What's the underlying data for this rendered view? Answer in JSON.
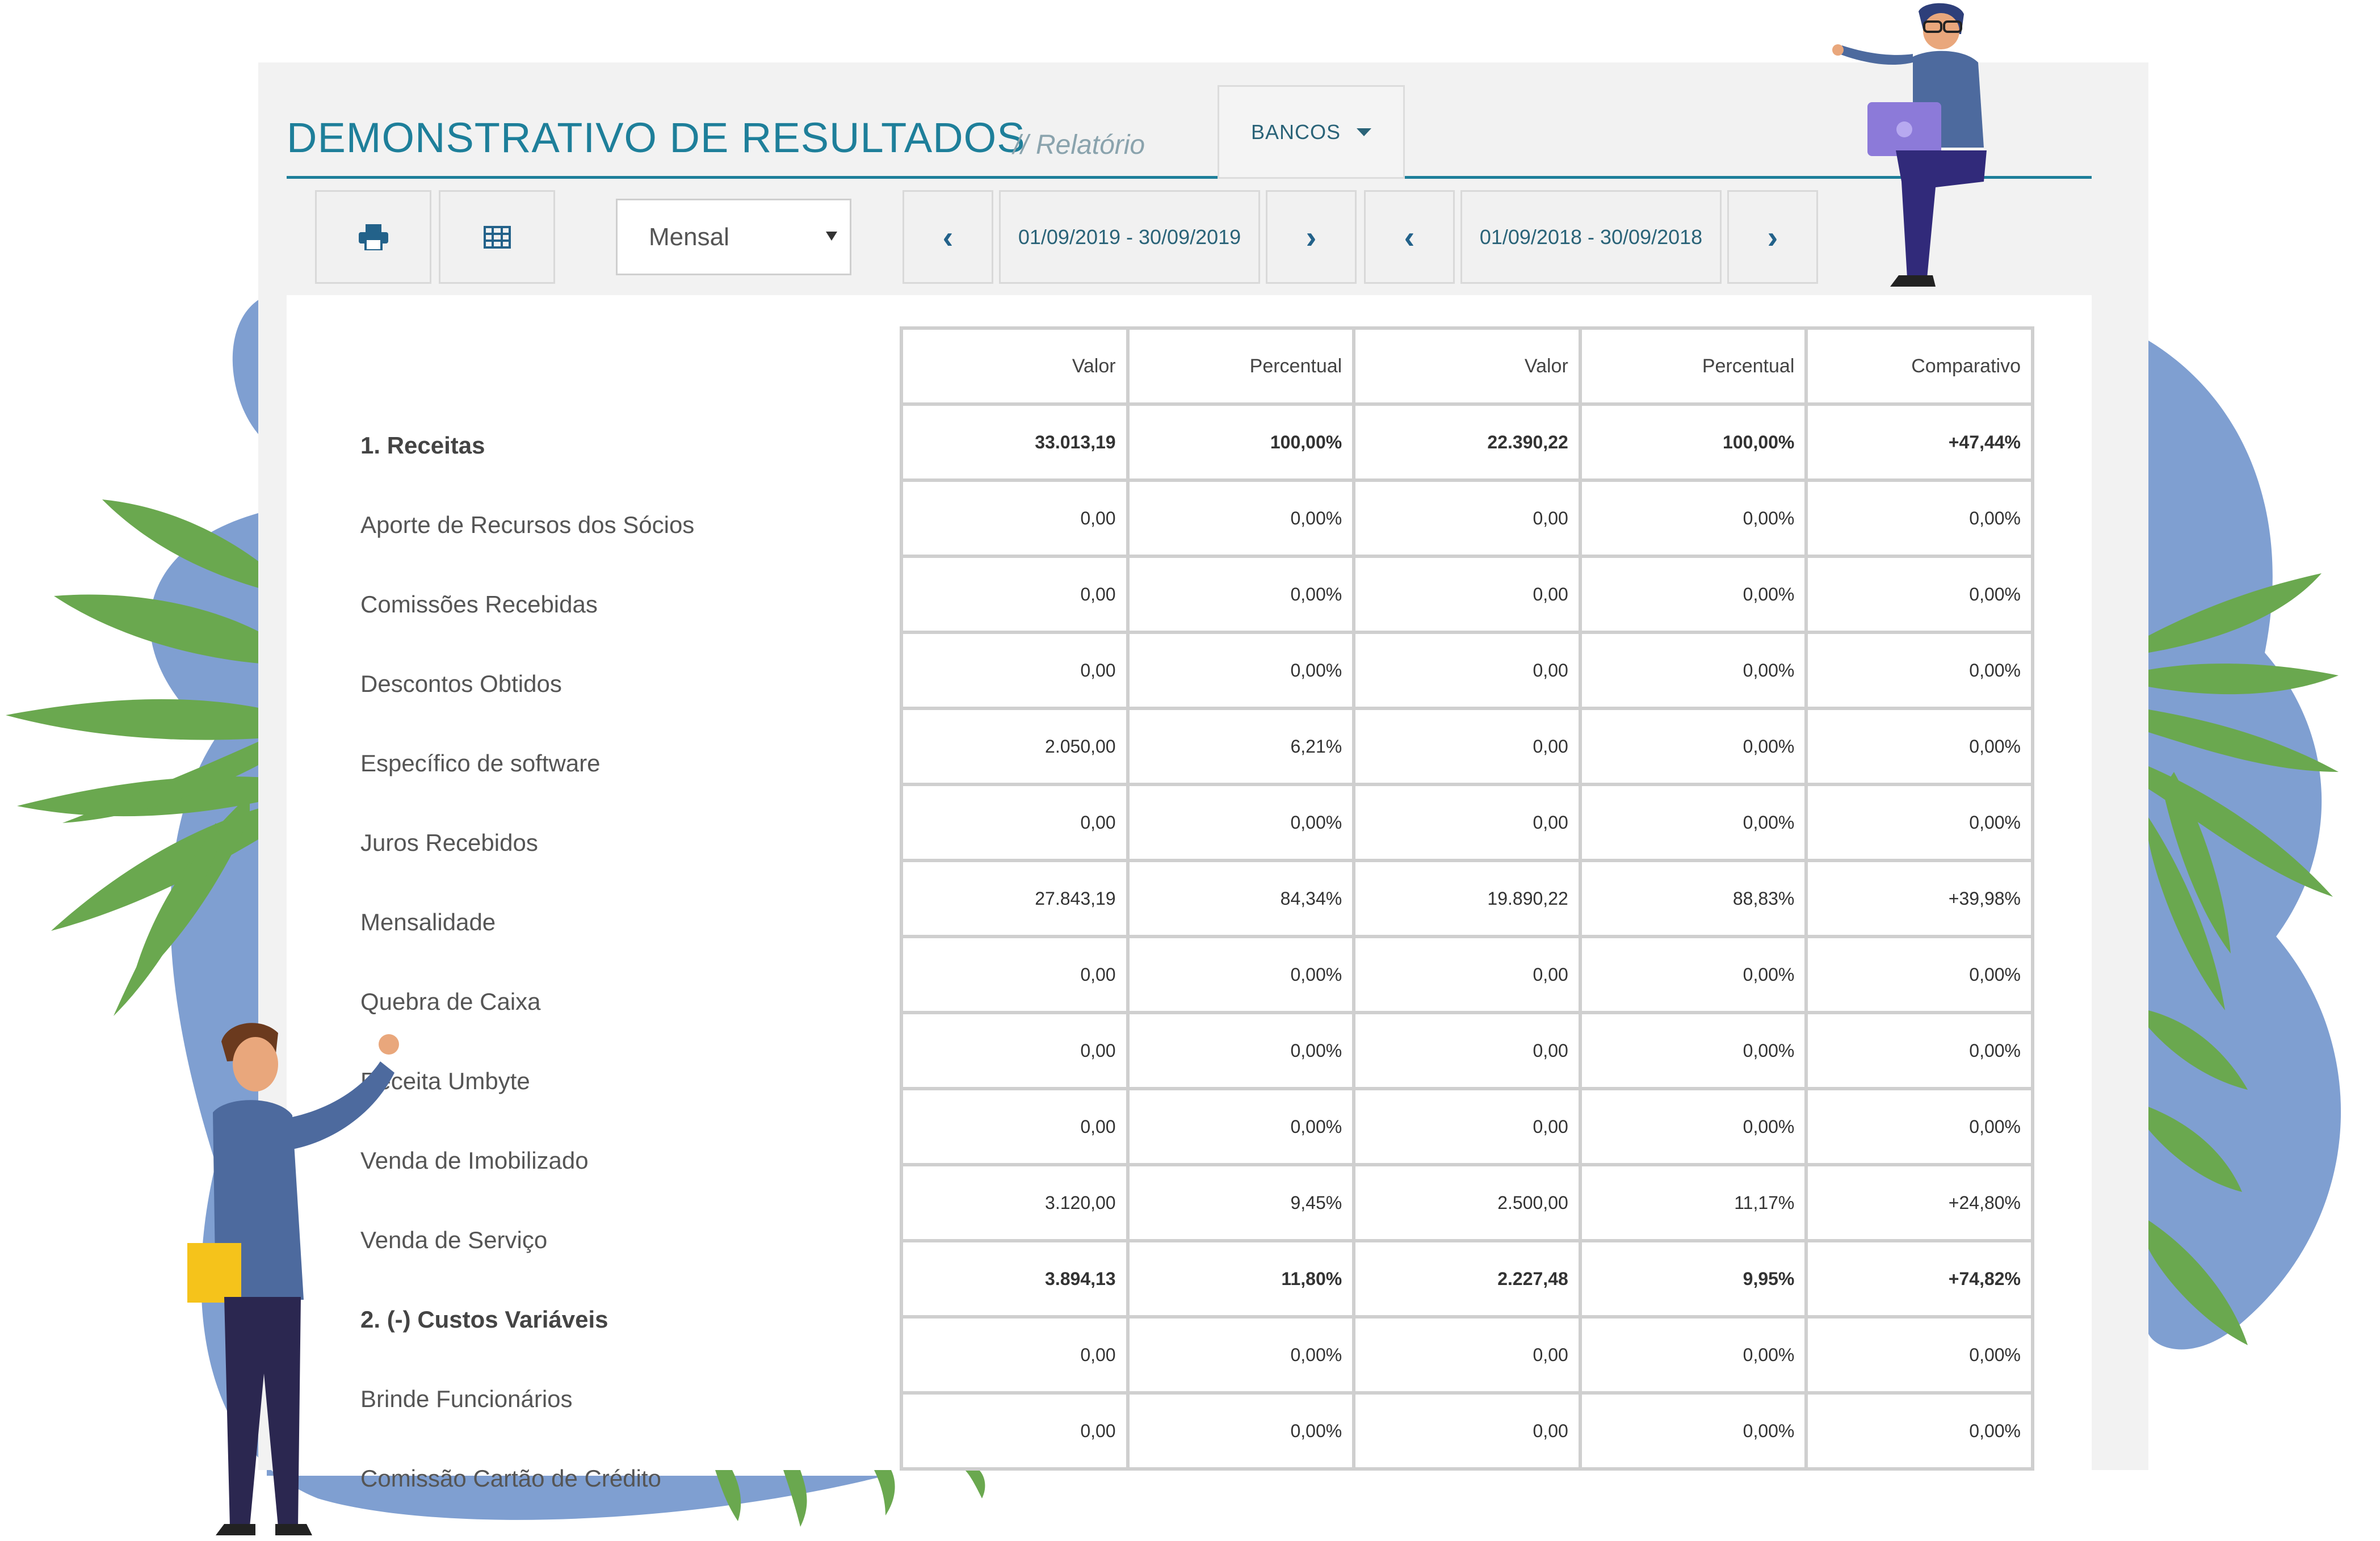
{
  "header": {
    "title": "DEMONSTRATIVO DE RESULTADOS",
    "subtitle": "// Relatório",
    "bancos_label": "BANCOS"
  },
  "toolbar": {
    "print_icon": "printer-icon",
    "table_icon": "table-icon",
    "period_select": "Mensal",
    "range_current": "01/09/2019 - 30/09/2019",
    "range_compare": "01/09/2018 - 30/09/2018"
  },
  "colors": {
    "accent": "#1e7f9a",
    "link": "#2a6378",
    "leaf": "#6aa84f",
    "blob": "#7f9fd1"
  },
  "table": {
    "columns": [
      "Valor",
      "Percentual",
      "Valor",
      "Percentual",
      "Comparativo"
    ],
    "rows": [
      {
        "label": "1. Receitas",
        "bold": true,
        "cells": [
          "33.013,19",
          "100,00%",
          "22.390,22",
          "100,00%",
          "+47,44%"
        ]
      },
      {
        "label": "Aporte de Recursos dos Sócios",
        "bold": false,
        "cells": [
          "0,00",
          "0,00%",
          "0,00",
          "0,00%",
          "0,00%"
        ]
      },
      {
        "label": "Comissões Recebidas",
        "bold": false,
        "cells": [
          "0,00",
          "0,00%",
          "0,00",
          "0,00%",
          "0,00%"
        ]
      },
      {
        "label": "Descontos Obtidos",
        "bold": false,
        "cells": [
          "0,00",
          "0,00%",
          "0,00",
          "0,00%",
          "0,00%"
        ]
      },
      {
        "label": "Específico de software",
        "bold": false,
        "cells": [
          "2.050,00",
          "6,21%",
          "0,00",
          "0,00%",
          "0,00%"
        ]
      },
      {
        "label": "Juros Recebidos",
        "bold": false,
        "cells": [
          "0,00",
          "0,00%",
          "0,00",
          "0,00%",
          "0,00%"
        ]
      },
      {
        "label": "Mensalidade",
        "bold": false,
        "cells": [
          "27.843,19",
          "84,34%",
          "19.890,22",
          "88,83%",
          "+39,98%"
        ]
      },
      {
        "label": "Quebra de Caixa",
        "bold": false,
        "cells": [
          "0,00",
          "0,00%",
          "0,00",
          "0,00%",
          "0,00%"
        ]
      },
      {
        "label": "Receita Umbyte",
        "bold": false,
        "cells": [
          "0,00",
          "0,00%",
          "0,00",
          "0,00%",
          "0,00%"
        ]
      },
      {
        "label": "Venda de Imobilizado",
        "bold": false,
        "cells": [
          "0,00",
          "0,00%",
          "0,00",
          "0,00%",
          "0,00%"
        ]
      },
      {
        "label": "Venda de Serviço",
        "bold": false,
        "cells": [
          "3.120,00",
          "9,45%",
          "2.500,00",
          "11,17%",
          "+24,80%"
        ]
      },
      {
        "label": "2. (-) Custos Variáveis",
        "bold": true,
        "cells": [
          "3.894,13",
          "11,80%",
          "2.227,48",
          "9,95%",
          "+74,82%"
        ]
      },
      {
        "label": "Brinde Funcionários",
        "bold": false,
        "cells": [
          "0,00",
          "0,00%",
          "0,00",
          "0,00%",
          "0,00%"
        ]
      },
      {
        "label": "Comissão Cartão de Crédito",
        "bold": false,
        "cells": [
          "0,00",
          "0,00%",
          "0,00",
          "0,00%",
          "0,00%"
        ]
      }
    ]
  }
}
